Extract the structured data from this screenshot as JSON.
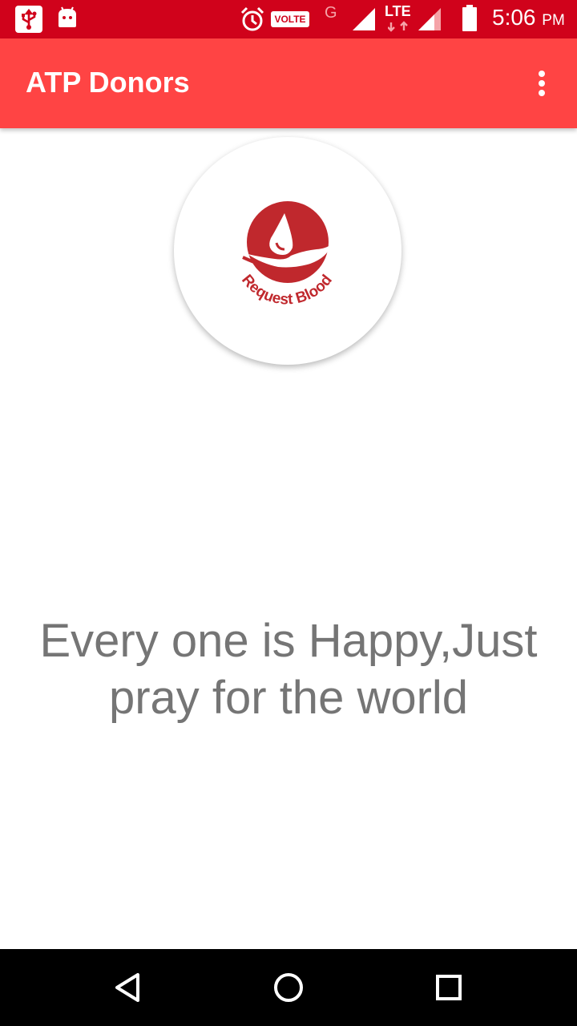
{
  "status_bar": {
    "volte_label": "VOLTE",
    "network_g": "G",
    "network_lte": "LTE",
    "time": "5:06",
    "ampm": "PM",
    "icons": [
      "usb-icon",
      "android-icon",
      "alarm-icon",
      "volte-icon",
      "signal-icon",
      "signal-icon-2",
      "battery-icon"
    ]
  },
  "app_bar": {
    "title": "ATP Donors",
    "menu_icon": "overflow-menu-icon"
  },
  "logo": {
    "text": "Request Blood",
    "brand_color": "#c0282d"
  },
  "main": {
    "message": "Every one is Happy,Just pray for the world"
  },
  "nav_bar": {
    "icons": [
      "back-icon",
      "home-icon",
      "recents-icon"
    ]
  },
  "colors": {
    "status_bar": "#d0021b",
    "app_bar": "#ff4444",
    "text_gray": "#757575"
  }
}
